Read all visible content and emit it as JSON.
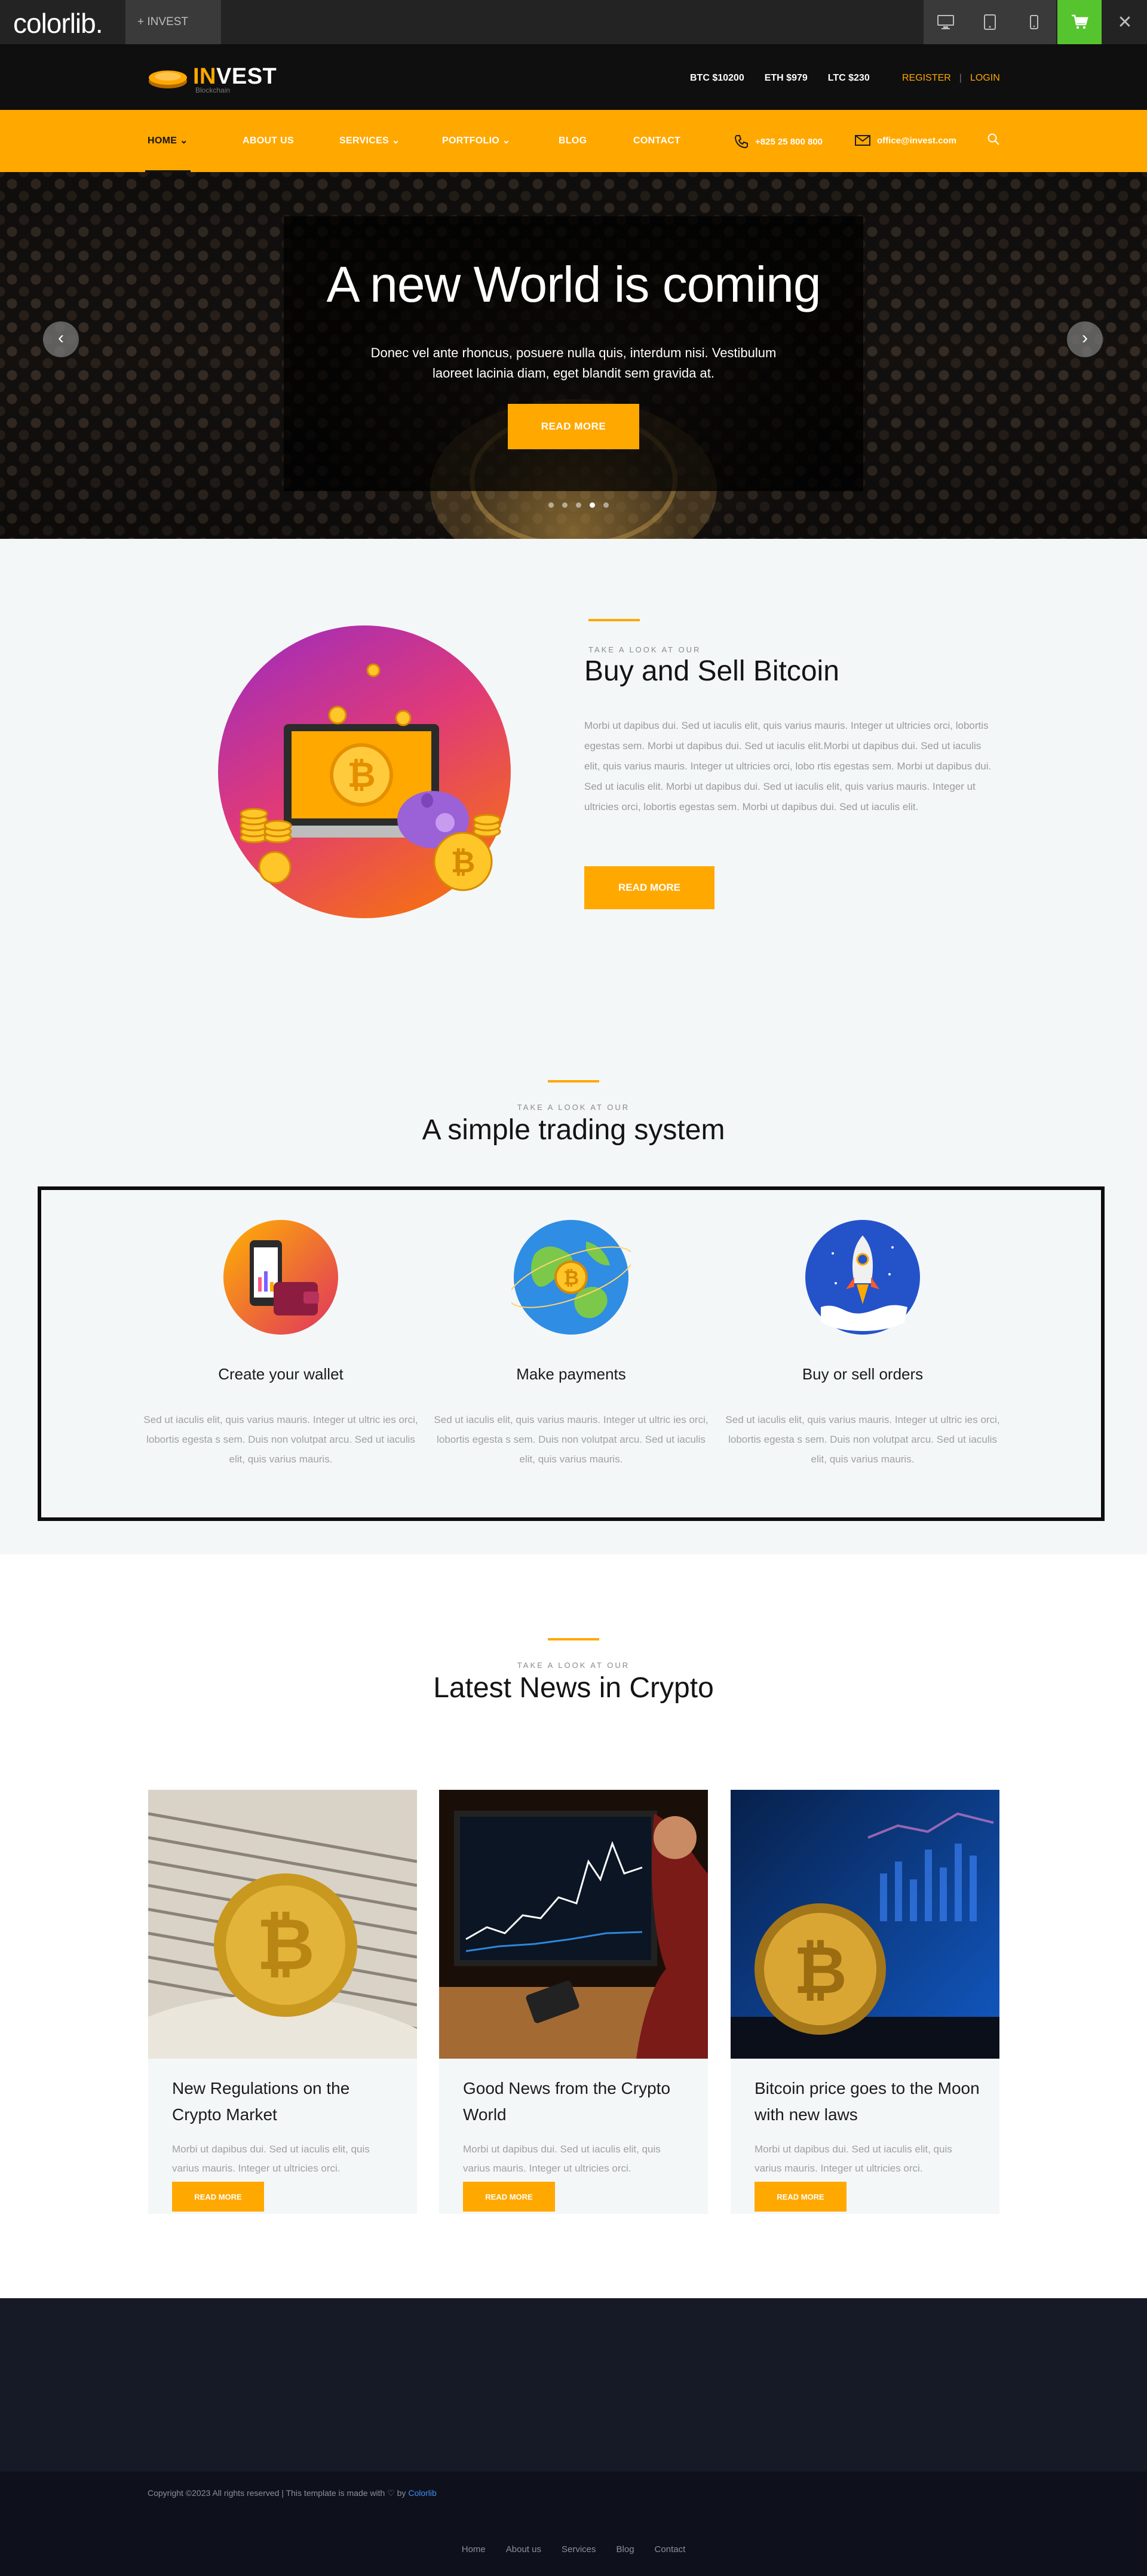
{
  "demobar": {
    "logo": "colorlib.",
    "tab_label": "+ INVEST",
    "devices": [
      "desktop-icon",
      "tablet-icon",
      "mobile-icon"
    ],
    "cart_icon": "cart-icon",
    "close_icon": "close-icon"
  },
  "header": {
    "brand_in": "IN",
    "brand_vest": "VEST",
    "brand_sub": "Blockchain",
    "prices": [
      "BTC $10200",
      "ETH $979",
      "LTC $230"
    ],
    "register": "REGISTER",
    "separator": "|",
    "login": "LOGIN"
  },
  "nav": {
    "items": [
      {
        "label": "HOME",
        "arrow": "⌄"
      },
      {
        "label": "ABOUT US",
        "arrow": ""
      },
      {
        "label": "SERVICES",
        "arrow": "⌄"
      },
      {
        "label": "PORTFOLIO",
        "arrow": "⌄"
      },
      {
        "label": "BLOG",
        "arrow": ""
      },
      {
        "label": "CONTACT",
        "arrow": ""
      }
    ],
    "phone": "+825 25 800 800",
    "email": "office@invest.com"
  },
  "hero": {
    "title": "A new World is coming",
    "text": "Donec vel ante rhoncus, posuere nulla quis, interdum nisi. Vestibulum laoreet lacinia diam, eget blandit sem gravida at.",
    "button": "READ MORE",
    "prev": "‹",
    "next": "›"
  },
  "buysell": {
    "eyebrow": "TAKE A LOOK AT OUR",
    "title": "Buy and Sell Bitcoin",
    "text": "Morbi ut dapibus dui. Sed ut iaculis elit, quis varius mauris. Integer ut ultricies orci, lobortis egestas sem. Morbi ut dapibus dui. Sed ut iaculis elit.Morbi ut dapibus dui. Sed ut iaculis elit, quis varius mauris. Integer ut ultricies orci, lobo rtis egestas sem. Morbi ut dapibus dui. Sed ut iaculis elit. Morbi ut dapibus dui. Sed ut iaculis elit, quis varius mauris. Integer ut ultricies orci, lobortis egestas sem. Morbi ut dapibus dui. Sed ut iaculis elit.",
    "button": "READ MORE"
  },
  "trading": {
    "eyebrow": "TAKE A LOOK AT OUR",
    "title": "A simple trading system",
    "features": [
      {
        "title": "Create your wallet",
        "text": "Sed ut iaculis elit, quis varius mauris. Integer ut ultric ies orci, lobortis egesta s sem. Duis non volutpat arcu. Sed ut iaculis elit, quis varius mauris."
      },
      {
        "title": "Make payments",
        "text": "Sed ut iaculis elit, quis varius mauris. Integer ut ultric ies orci, lobortis egesta s sem. Duis non volutpat arcu. Sed ut iaculis elit, quis varius mauris."
      },
      {
        "title": "Buy or sell orders",
        "text": "Sed ut iaculis elit, quis varius mauris. Integer ut ultric ies orci, lobortis egesta s sem. Duis non volutpat arcu. Sed ut iaculis elit, quis varius mauris."
      }
    ]
  },
  "news": {
    "eyebrow": "TAKE A LOOK AT OUR",
    "title": "Latest News in Crypto",
    "cards": [
      {
        "title": "New Regulations on the Crypto Market",
        "text": "Morbi ut dapibus dui. Sed ut iaculis elit, quis varius mauris. Integer ut ultricies orci.",
        "button": "READ MORE"
      },
      {
        "title": "Good News from the Crypto World",
        "text": "Morbi ut dapibus dui. Sed ut iaculis elit, quis varius mauris. Integer ut ultricies orci.",
        "button": "READ MORE"
      },
      {
        "title": "Bitcoin price goes to the Moon with new laws",
        "text": "Morbi ut dapibus dui. Sed ut iaculis elit, quis varius mauris. Integer ut ultricies orci.",
        "button": "READ MORE"
      }
    ]
  },
  "footer": {
    "copyright": "Copyright ©2023 All rights reserved | This template is made with ♡ by",
    "author": "Colorlib",
    "links": [
      "Home",
      "About us",
      "Services",
      "Blog",
      "Contact"
    ]
  },
  "colors": {
    "accent": "#ffa800",
    "dark": "#0f0f0f",
    "section_bg": "#f4f7f8",
    "footer": "#161a26",
    "footer_bottom": "#0e111c",
    "link": "#3e8ef7"
  }
}
